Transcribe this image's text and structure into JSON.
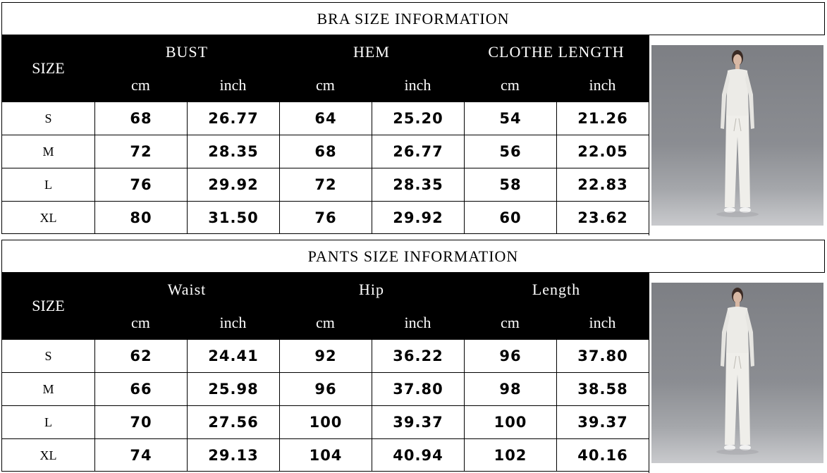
{
  "tables": [
    {
      "title": "BRA SIZE INFORMATION",
      "size_label": "SIZE",
      "groups": [
        {
          "name": "BUST",
          "units": [
            "cm",
            "inch"
          ]
        },
        {
          "name": "HEM",
          "units": [
            "cm",
            "inch"
          ]
        },
        {
          "name": "CLOTHE LENGTH",
          "units": [
            "cm",
            "inch"
          ]
        }
      ],
      "rows": [
        {
          "size": "S",
          "values": [
            "68",
            "26.77",
            "64",
            "25.20",
            "54",
            "21.26"
          ]
        },
        {
          "size": "M",
          "values": [
            "72",
            "28.35",
            "68",
            "26.77",
            "56",
            "22.05"
          ]
        },
        {
          "size": "L",
          "values": [
            "76",
            "29.92",
            "72",
            "28.35",
            "58",
            "22.83"
          ]
        },
        {
          "size": "XL",
          "values": [
            "80",
            "31.50",
            "76",
            "29.92",
            "60",
            "23.62"
          ]
        }
      ]
    },
    {
      "title": "PANTS SIZE INFORMATION",
      "size_label": "SIZE",
      "groups": [
        {
          "name": "Waist",
          "units": [
            "cm",
            "inch"
          ]
        },
        {
          "name": "Hip",
          "units": [
            "cm",
            "inch"
          ]
        },
        {
          "name": "Length",
          "units": [
            "cm",
            "inch"
          ]
        }
      ],
      "rows": [
        {
          "size": "S",
          "values": [
            "62",
            "24.41",
            "92",
            "36.22",
            "96",
            "37.80"
          ]
        },
        {
          "size": "M",
          "values": [
            "66",
            "25.98",
            "96",
            "37.80",
            "98",
            "38.58"
          ]
        },
        {
          "size": "L",
          "values": [
            "70",
            "27.56",
            "100",
            "39.37",
            "100",
            "39.37"
          ]
        },
        {
          "size": "XL",
          "values": [
            "74",
            "29.13",
            "104",
            "40.94",
            "102",
            "40.16"
          ]
        }
      ]
    }
  ]
}
